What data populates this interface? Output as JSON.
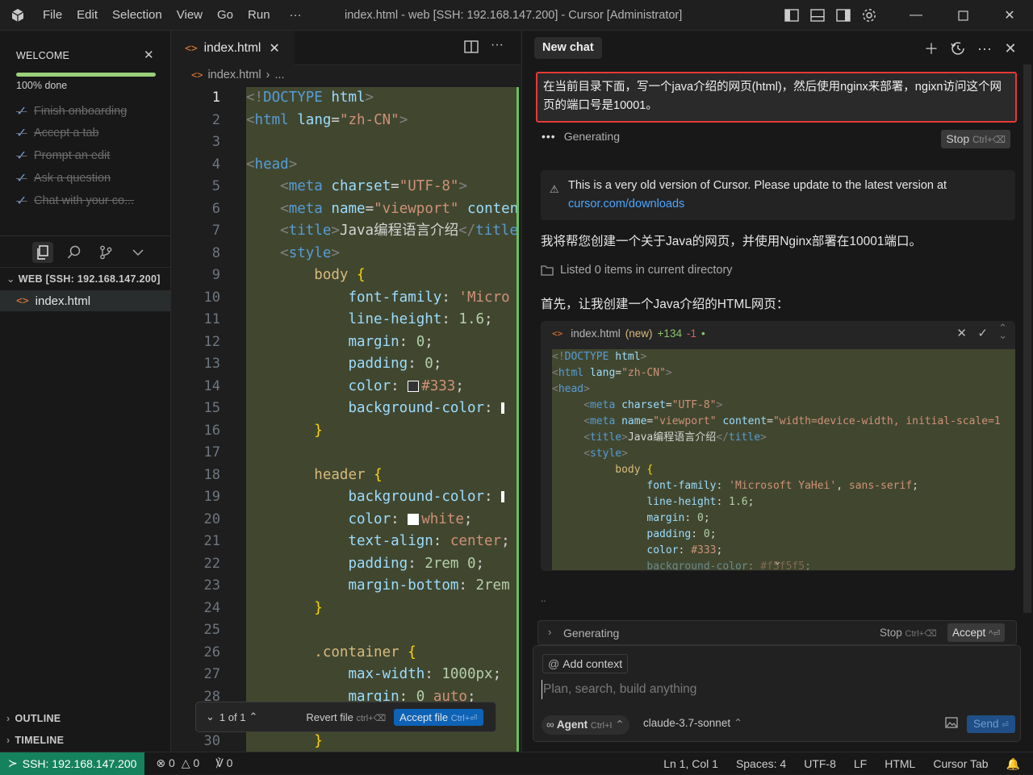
{
  "window": {
    "title": "index.html - web [SSH: 192.168.147.200] - Cursor [Administrator]",
    "menu": [
      "File",
      "Edit",
      "Selection",
      "View",
      "Go",
      "Run",
      "···"
    ]
  },
  "sidebar": {
    "welcome_title": "WELCOME",
    "progress_text": "100% done",
    "progress": 1.0,
    "checklist": [
      "Finish onboarding",
      "Accept a tab",
      "Prompt an edit",
      "Ask a question",
      "Chat with your co..."
    ],
    "explorer_header": "WEB [SSH: 192.168.147.200]",
    "file": "index.html",
    "outline": "OUTLINE",
    "timeline": "TIMELINE"
  },
  "editor": {
    "tab": "index.html",
    "breadcrumb_file": "index.html",
    "breadcrumb_more": "...",
    "line_numbers": [
      "1",
      "2",
      "3",
      "4",
      "5",
      "6",
      "7",
      "8",
      "9",
      "10",
      "11",
      "12",
      "13",
      "14",
      "15",
      "16",
      "17",
      "18",
      "19",
      "20",
      "21",
      "22",
      "23",
      "24",
      "25",
      "26",
      "27",
      "28",
      "29",
      "30"
    ],
    "diff_nav": "1 of 1",
    "revert_label": "Revert file",
    "revert_shortcut": "ctrl+⌫",
    "accept_label": "Accept file",
    "accept_shortcut": "Ctrl+⏎"
  },
  "chat": {
    "tab_label": "New chat",
    "prompt": "在当前目录下面，写一个java介绍的网页(html)，然后使用nginx来部署，ngixn访问这个网页的端口号是10001。",
    "generating": "Generating",
    "stop": "Stop",
    "stop_shortcut": "Ctrl+⌫",
    "notice_text": "This is a very old version of Cursor. Please update to the latest version at",
    "notice_link": "cursor.com/downloads",
    "reply1": "我将帮您创建一个关于Java的网页，并使用Nginx部署在10001端口。",
    "listed": "Listed 0 items in current directory",
    "reply2": "首先，让我创建一个Java介绍的HTML网页：",
    "file_card": {
      "name": "index.html",
      "status": "(new)",
      "added": "+134",
      "removed": "-1"
    },
    "ellipsis": "..",
    "generating2": "Generating",
    "stop2": "Stop",
    "stop2_shortcut": "Ctrl+⌫",
    "accept": "Accept",
    "accept_shortcut": "^⏎",
    "add_context": "Add context",
    "input_placeholder": "Plan, search, build anything",
    "agent": "Agent",
    "agent_shortcut": "Ctrl+I",
    "model": "claude-3.7-sonnet",
    "send": "Send"
  },
  "statusbar": {
    "remote": "SSH: 192.168.147.200",
    "errors": "0",
    "warnings": "0",
    "ports": "0",
    "position": "Ln 1, Col 1",
    "spaces": "Spaces: 4",
    "encoding": "UTF-8",
    "eol": "LF",
    "language": "HTML",
    "cursor_tab": "Cursor Tab"
  },
  "colors": {
    "accent_green": "#16825d",
    "diff_bg": "#41472f",
    "highlight_border": "#e53935",
    "link": "#4da6ff"
  }
}
